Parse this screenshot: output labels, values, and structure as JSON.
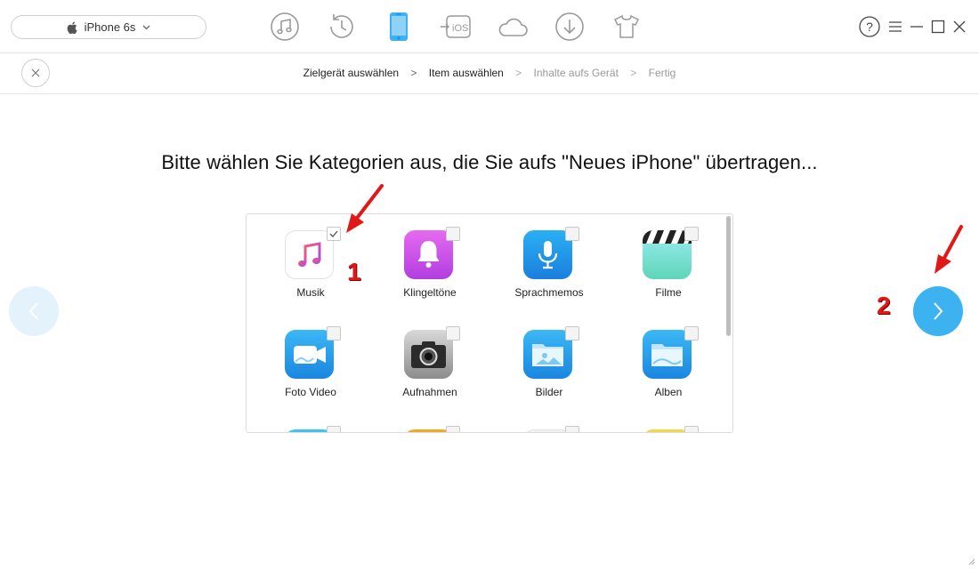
{
  "device": {
    "name": "iPhone 6s",
    "icon": "apple-logo-icon"
  },
  "toolbar": {
    "icons": [
      "music-note-icon",
      "history-clock-icon",
      "phone-icon",
      "ios-transfer-icon",
      "cloud-icon",
      "download-icon",
      "tshirt-icon"
    ],
    "active": "phone-icon",
    "accent": "#3db2f0"
  },
  "window_controls": [
    "help-icon",
    "menu-icon",
    "minimize-icon",
    "maximize-icon",
    "close-icon"
  ],
  "breadcrumb": {
    "steps": [
      {
        "label": "Zielgerät auswählen",
        "active": true
      },
      {
        "label": "Item auswählen",
        "active": true
      },
      {
        "label": "Inhalte aufs Gerät",
        "active": false
      },
      {
        "label": "Fertig",
        "active": false
      }
    ],
    "separator": ">"
  },
  "heading": "Bitte wählen Sie Kategorien aus, die Sie aufs \"Neues iPhone\" übertragen...",
  "categories": [
    {
      "label": "Musik",
      "icon": "music-icon",
      "checked": true
    },
    {
      "label": "Klingeltöne",
      "icon": "bell-icon",
      "checked": false
    },
    {
      "label": "Sprachmemos",
      "icon": "microphone-icon",
      "checked": false
    },
    {
      "label": "Filme",
      "icon": "clapperboard-icon",
      "checked": false
    },
    {
      "label": "Foto Video",
      "icon": "video-camera-icon",
      "checked": false
    },
    {
      "label": "Aufnahmen",
      "icon": "camera-icon",
      "checked": false
    },
    {
      "label": "Bilder",
      "icon": "picture-folder-icon",
      "checked": false
    },
    {
      "label": "Alben",
      "icon": "album-folder-icon",
      "checked": false
    }
  ],
  "annotations": [
    {
      "number": "1",
      "color": "#e01818"
    },
    {
      "number": "2",
      "color": "#e01818"
    }
  ]
}
